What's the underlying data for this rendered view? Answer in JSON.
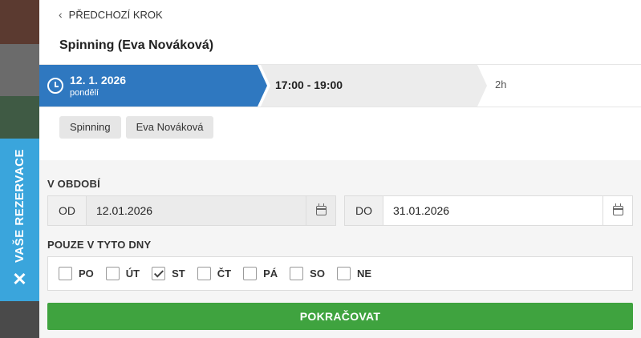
{
  "nav": {
    "back_label": "PŘEDCHOZÍ KROK"
  },
  "header": {
    "title": "Spinning (Eva Nováková)"
  },
  "slot": {
    "date": "12. 1. 2026",
    "weekday": "pondělí",
    "time": "17:00 - 19:00",
    "duration": "2h"
  },
  "tags": [
    "Spinning",
    "Eva Nováková"
  ],
  "period": {
    "label": "V OBDOBÍ",
    "from_prefix": "OD",
    "from_value": "12.01.2026",
    "to_prefix": "DO",
    "to_value": "31.01.2026"
  },
  "days": {
    "label": "POUZE V TYTO DNY",
    "items": [
      {
        "label": "PO",
        "checked": false
      },
      {
        "label": "ÚT",
        "checked": false
      },
      {
        "label": "ST",
        "checked": true
      },
      {
        "label": "ČT",
        "checked": false
      },
      {
        "label": "PÁ",
        "checked": false
      },
      {
        "label": "SO",
        "checked": false
      },
      {
        "label": "NE",
        "checked": false
      }
    ]
  },
  "actions": {
    "continue_label": "POKRAČOVAT"
  },
  "side_tab": {
    "label": "VAŠE REZERVACE"
  },
  "colors": {
    "primary": "#2f78c0",
    "accent_tab": "#3aa5dc",
    "success": "#3fa33f"
  }
}
